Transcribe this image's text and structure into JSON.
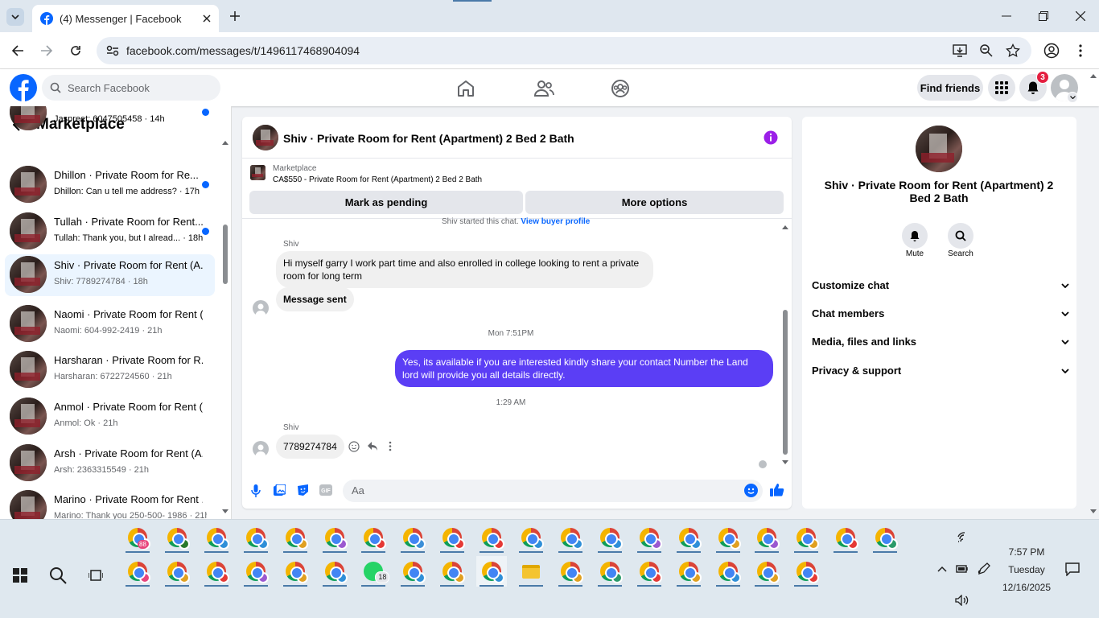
{
  "browser": {
    "tab_title": "(4) Messenger | Facebook",
    "url": "facebook.com/messages/t/1496117468904094"
  },
  "fb_header": {
    "search_placeholder": "Search Facebook",
    "find_friends": "Find friends",
    "notification_count": "3"
  },
  "sidebar": {
    "title": "Marketplace",
    "conversations": [
      {
        "name": "",
        "preview": "Jaspreet: 6047505458 · 14h",
        "unread": true
      },
      {
        "name": "Dhillon · Private Room for Re...",
        "preview": "Dhillon: Can u tell me address? · 17h",
        "unread": true
      },
      {
        "name": "Tullah · Private Room for Rent...",
        "preview": "Tullah: Thank you, but I alread... · 18h",
        "unread": true
      },
      {
        "name": "Shiv · Private Room for Rent (A...",
        "preview": "Shiv: 7789274784 · 18h",
        "unread": false
      },
      {
        "name": "Naomi · Private Room for Rent (...",
        "preview": "Naomi: 604-992-2419 · 21h",
        "unread": false
      },
      {
        "name": "Harsharan · Private Room for R...",
        "preview": "Harsharan: 6722724560 · 21h",
        "unread": false
      },
      {
        "name": "Anmol · Private Room for Rent (...",
        "preview": "Anmol: Ok · 21h",
        "unread": false
      },
      {
        "name": "Arsh · Private Room for Rent (A...",
        "preview": "Arsh: 2363315549 · 21h",
        "unread": false
      },
      {
        "name": "Marino · Private Room for Rent ...",
        "preview": "Marino: Thank you 250-500- 1986 · 21h",
        "unread": false
      }
    ]
  },
  "chat": {
    "title": "Shiv · Private Room for Rent (Apartment) 2 Bed 2 Bath",
    "listing_label": "Marketplace",
    "listing_detail": "CA$550 - Private Room for Rent (Apartment) 2 Bed 2 Bath",
    "mark_pending": "Mark as pending",
    "more_options": "More options",
    "started_text": "Shiv started this chat.",
    "view_buyer": "View buyer profile",
    "sender1": "Shiv",
    "msg1": "Hi myself garry I work part time and also enrolled in college looking to rent a private room for long term",
    "msg2": "Message sent",
    "time1": "Mon 7:51PM",
    "msg3": "Yes, its available if you are interested kindly share your contact Number the Land lord will provide you all details directly.",
    "time2": "1:29 AM",
    "sender2": "Shiv",
    "msg4": "7789274784",
    "compose_placeholder": "Aa"
  },
  "info_panel": {
    "title": "Shiv · Private Room for Rent (Apartment) 2 Bed 2 Bath",
    "mute": "Mute",
    "search": "Search",
    "sections": [
      "Customize chat",
      "Chat members",
      "Media, files and links",
      "Privacy & support"
    ]
  },
  "taskbar": {
    "time": "7:57 PM",
    "day": "Tuesday",
    "date": "12/16/2025",
    "whatsapp_badge": "18",
    "first_app_badge": "88"
  },
  "colors": {
    "fb_blue": "#0866ff",
    "messenger_purple": "#5b3ef5",
    "info_icon": "#9b1fe8",
    "notification_red": "#e41e3f"
  }
}
